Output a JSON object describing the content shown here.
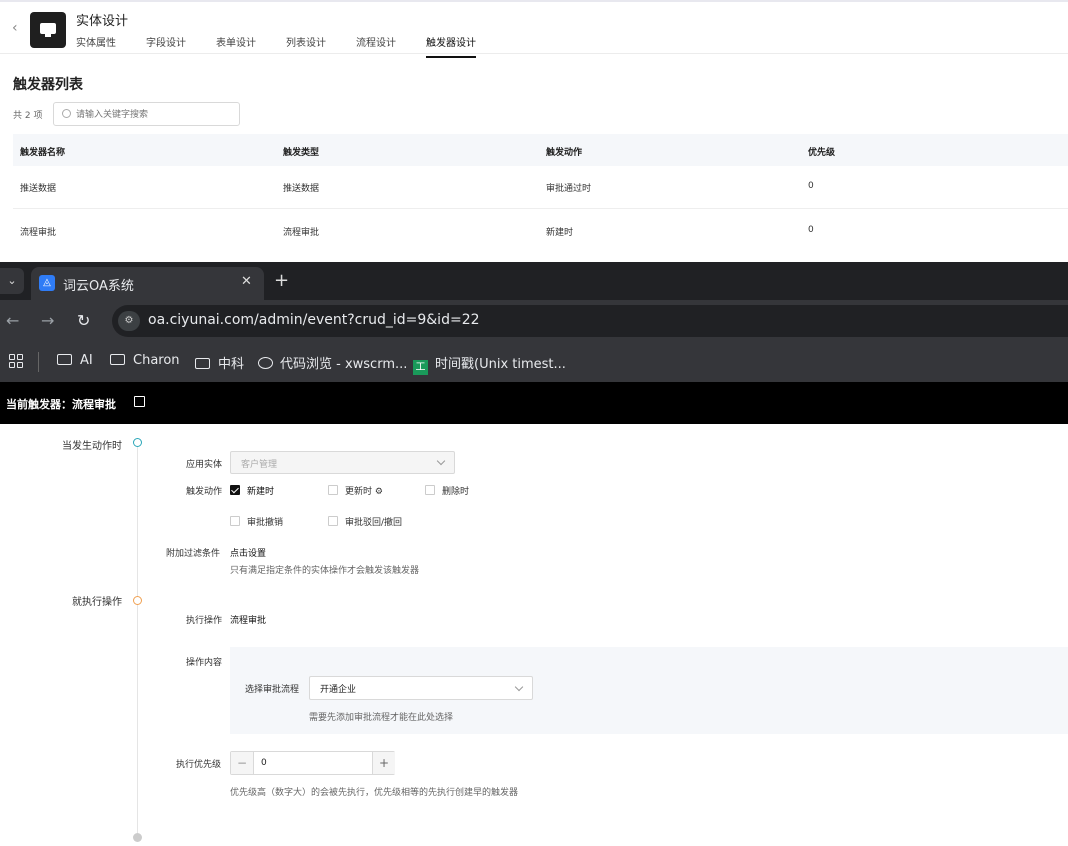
{
  "app": {
    "title": "实体设计",
    "tabs": [
      "实体属性",
      "字段设计",
      "表单设计",
      "列表设计",
      "流程设计",
      "触发器设计"
    ],
    "active_tab": "触发器设计"
  },
  "trigger_list": {
    "heading": "触发器列表",
    "count": "共 2 项",
    "search_placeholder": "请输入关键字搜索",
    "columns": [
      "触发器名称",
      "触发类型",
      "触发动作",
      "优先级"
    ],
    "rows": [
      [
        "推送数据",
        "推送数据",
        "审批通过时",
        "0"
      ],
      [
        "流程审批",
        "流程审批",
        "新建时",
        "0"
      ]
    ]
  },
  "browser": {
    "tab_title": "词云OA系统",
    "url": "oa.ciyunai.com/admin/event?crud_id=9&id=22",
    "bookmarks": [
      "AI",
      "Charon",
      "中科",
      "代码浏览 - xwscrm...",
      "时间戳(Unix timest..."
    ]
  },
  "editor": {
    "title": "当前触发器：流程审批",
    "step1_label": "当发生动作时",
    "entity_label": "应用实体",
    "entity_value": "客户管理",
    "action_label": "触发动作",
    "actions": [
      {
        "label": "新建时",
        "checked": true
      },
      {
        "label": "更新时 ⚙",
        "checked": false
      },
      {
        "label": "删除时",
        "checked": false
      },
      {
        "label": "审批撤销",
        "checked": false
      },
      {
        "label": "审批驳回/撤回",
        "checked": false
      }
    ],
    "filter_label": "附加过滤条件",
    "filter_link": "点击设置",
    "filter_hint": "只有满足指定条件的实体操作才会触发该触发器",
    "step2_label": "就执行操作",
    "exec_label": "执行操作",
    "exec_value": "流程审批",
    "content_label": "操作内容",
    "flow_label": "选择审批流程",
    "flow_value": "开通企业",
    "flow_hint": "需要先添加审批流程才能在此处选择",
    "priority_label": "执行优先级",
    "priority_value": "0",
    "priority_hint": "优先级高（数字大）的会被先执行，优先级相等的先执行创建早的触发器"
  },
  "colors": {
    "accent_dot_1": "#2aa6b8",
    "accent_dot_2": "#f0a050",
    "header_black": "#000000",
    "browser_dark": "#202124"
  }
}
